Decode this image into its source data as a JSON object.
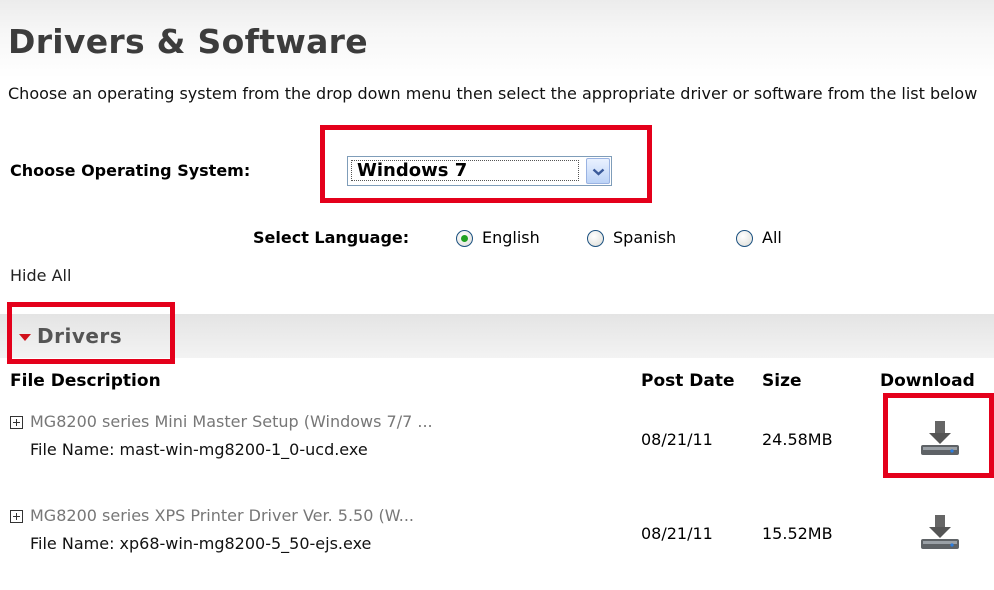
{
  "page": {
    "title": "Drivers & Software",
    "intro": "Choose an operating system from the drop down menu then select the appropriate driver or software from the list below"
  },
  "os": {
    "label": "Choose Operating System:",
    "selected": "Windows 7"
  },
  "language": {
    "label": "Select Language:",
    "options": [
      "English",
      "Spanish",
      "All"
    ],
    "selected": "English"
  },
  "hide_all": "Hide All",
  "section": {
    "title": "Drivers",
    "columns": {
      "description": "File Description",
      "post_date": "Post Date",
      "size": "Size",
      "download": "Download"
    },
    "rows": [
      {
        "description": "MG8200 series Mini Master Setup (Windows 7/7 ...",
        "file_name": "File Name: mast-win-mg8200-1_0-ucd.exe",
        "post_date": "08/21/11",
        "size": "24.58MB"
      },
      {
        "description": "MG8200 series XPS Printer Driver Ver. 5.50 (W...",
        "file_name": "File Name: xp68-win-mg8200-5_50-ejs.exe",
        "post_date": "08/21/11",
        "size": "15.52MB"
      }
    ]
  },
  "icons": {
    "dropdown": "chevron-down-icon",
    "expand": "plus-box-icon",
    "collapse": "caret-down-icon",
    "download": "download-icon"
  },
  "colors": {
    "highlight": "#e4001b",
    "caret": "#d0101a",
    "radio_selected": "#21a121",
    "title": "#3c3c3c"
  }
}
